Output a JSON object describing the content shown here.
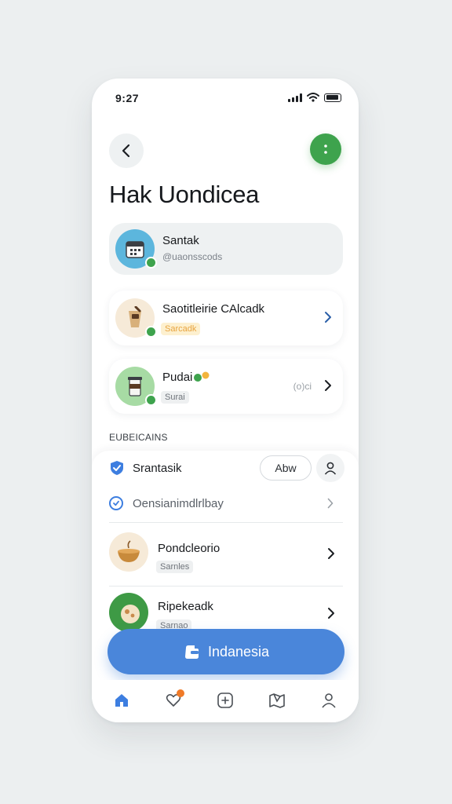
{
  "status_bar": {
    "time": "9:27"
  },
  "header": {
    "title": "Hak Uondicea"
  },
  "profile_card": {
    "name": "Santak",
    "handle": "@uaonsscods"
  },
  "cards": [
    {
      "title": "Saotitleirie CAlcadk",
      "tag": "Sarcadk"
    },
    {
      "title": "Pudai",
      "tag": "Surai",
      "count": "(o)ci"
    }
  ],
  "section": {
    "heading": "EUBEICAINS"
  },
  "sheet": {
    "top_row": {
      "label": "Srantasik",
      "apply_label": "Abw"
    },
    "check_row": {
      "label": "Oensianimdlrlbay"
    },
    "items": [
      {
        "title": "Pondcleorio",
        "tag": "Sarnles"
      },
      {
        "title": "Ripekeadk",
        "tag": "Sarnao"
      }
    ]
  },
  "primary_action": {
    "label": "Indanesia"
  },
  "tabs": [
    "home",
    "favorites",
    "add",
    "map",
    "profile"
  ],
  "colors": {
    "accent_blue": "#4a86da",
    "accent_green": "#3ea34d",
    "badge_orange": "#f07a27"
  }
}
